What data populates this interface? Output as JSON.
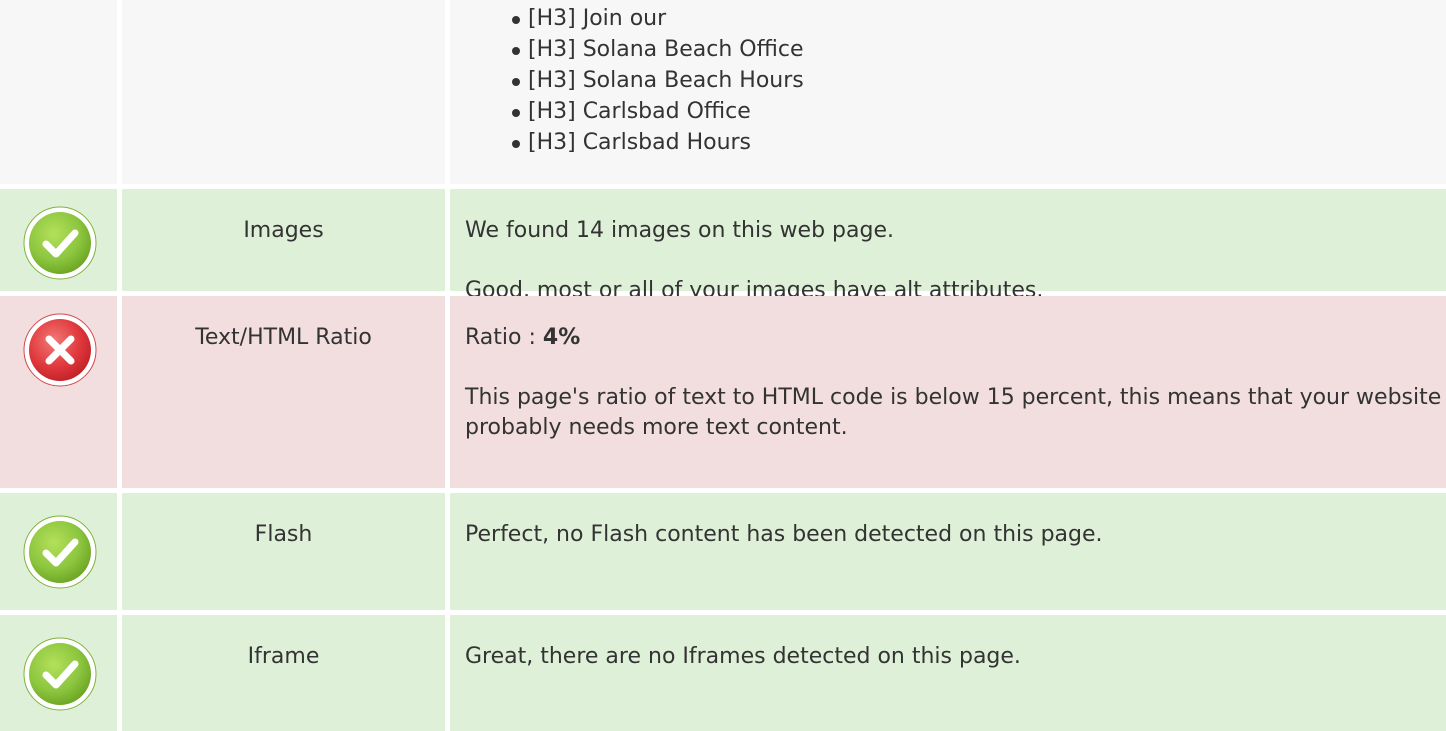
{
  "headings": {
    "items": [
      "[H3] Join our",
      "[H3] Solana Beach Office",
      "[H3] Solana Beach Hours",
      "[H3] Carlsbad Office",
      "[H3] Carlsbad Hours"
    ]
  },
  "rows": {
    "images": {
      "status": "pass",
      "label": "Images",
      "line1": "We found 14 images on this web page.",
      "line2": "Good, most or all of your images have alt attributes."
    },
    "ratio": {
      "status": "fail",
      "label": "Text/HTML Ratio",
      "ratio_prefix": "Ratio : ",
      "ratio_value": "4%",
      "line2": "This page's ratio of text to HTML code is below 15 percent, this means that your website probably needs more text content."
    },
    "flash": {
      "status": "pass",
      "label": "Flash",
      "line1": "Perfect, no Flash content has been detected on this page."
    },
    "iframe": {
      "status": "pass",
      "label": "Iframe",
      "line1": "Great, there are no Iframes detected on this page."
    }
  },
  "colors": {
    "pass_bg": "#dff0d8",
    "fail_bg": "#f2dede",
    "neutral_bg": "#f7f7f7",
    "pass_icon": "#8dc63f",
    "fail_icon": "#e0393e"
  },
  "icons": {
    "pass": "check-circle-icon",
    "fail": "x-circle-icon"
  }
}
